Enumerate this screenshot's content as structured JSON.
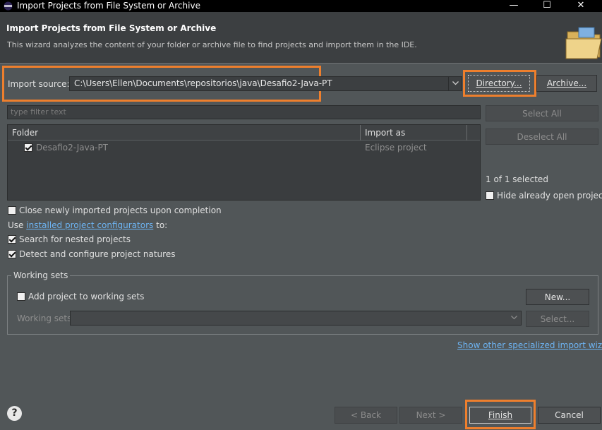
{
  "window": {
    "title": "Import Projects from File System or Archive",
    "controls": {
      "minimize": "—",
      "maximize": "☐",
      "close": "✕"
    }
  },
  "header": {
    "heading": "Import Projects from File System or Archive",
    "description": "This wizard analyzes the content of your folder or archive file to find projects and import them in the IDE."
  },
  "source": {
    "label": "Import source:",
    "value": "C:\\Users\\Ellen\\Documents\\repositorios\\java\\Desafio2-Java-PT",
    "directory_button": "Directory...",
    "archive_button": "Archive..."
  },
  "filter": {
    "placeholder": "type filter text"
  },
  "table": {
    "columns": [
      "Folder",
      "Import as"
    ],
    "rows": [
      {
        "folder": "Desafio2-Java-PT",
        "import_as": "Eclipse project",
        "checked": true
      }
    ]
  },
  "selection": {
    "select_all": "Select All",
    "deselect_all": "Deselect All",
    "count": "1 of 1 selected",
    "hide_open": "Hide already open projects"
  },
  "options": {
    "close_imported": "Close newly imported projects upon completion",
    "use_prefix": "Use",
    "configurators_link": "installed project configurators",
    "use_suffix": "to:",
    "search_nested": "Search for nested projects",
    "detect_natures": "Detect and configure project natures"
  },
  "working_sets": {
    "legend": "Working sets",
    "add_label": "Add project to working sets",
    "new_button": "New...",
    "sets_label": "Working sets:",
    "select_button": "Select..."
  },
  "specialized_link": "Show other specialized import wizards",
  "footer": {
    "help": "?",
    "back": "< Back",
    "next": "Next >",
    "finish": "Finish",
    "cancel": "Cancel"
  },
  "colors": {
    "highlight": "#ee7f2d",
    "background": "#515658",
    "header": "#3c3f41",
    "link": "#6db4f3"
  }
}
